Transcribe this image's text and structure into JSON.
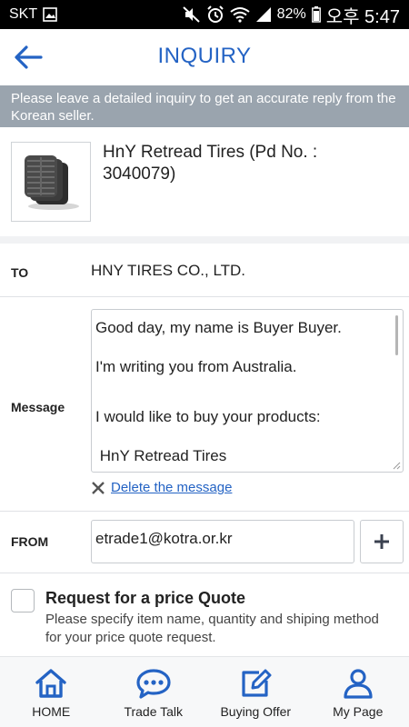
{
  "status": {
    "carrier": "SKT",
    "battery": "82%",
    "time": "오후 5:47"
  },
  "header": {
    "title": "INQUIRY"
  },
  "notice": "Please leave a detailed inquiry to get an accurate reply from the Korean seller.",
  "product": {
    "name": "HnY Retread Tires (Pd No. : 3040079)"
  },
  "to": {
    "label": "TO",
    "value": "HNY TIRES CO., LTD."
  },
  "message": {
    "label": "Message",
    "lines": [
      "Good day, my name is Buyer Buyer.",
      "I'm writing you from Australia.",
      "I would like to buy your products:",
      " HnY Retread Tires"
    ],
    "delete_label": "Delete the message"
  },
  "from": {
    "label": "FROM",
    "value": "etrade1@kotra.or.kr"
  },
  "quote": {
    "title": "Request for a price Quote",
    "description": "Please specify item name, quantity and shiping method for your price quote request."
  },
  "tabs": [
    {
      "label": "HOME",
      "icon": "home-icon"
    },
    {
      "label": "Trade Talk",
      "icon": "chat-icon"
    },
    {
      "label": "Buying Offer",
      "icon": "edit-icon"
    },
    {
      "label": "My Page",
      "icon": "user-icon"
    }
  ],
  "colors": {
    "accent": "#2463c4",
    "notice_bg": "#9aa4ae"
  }
}
